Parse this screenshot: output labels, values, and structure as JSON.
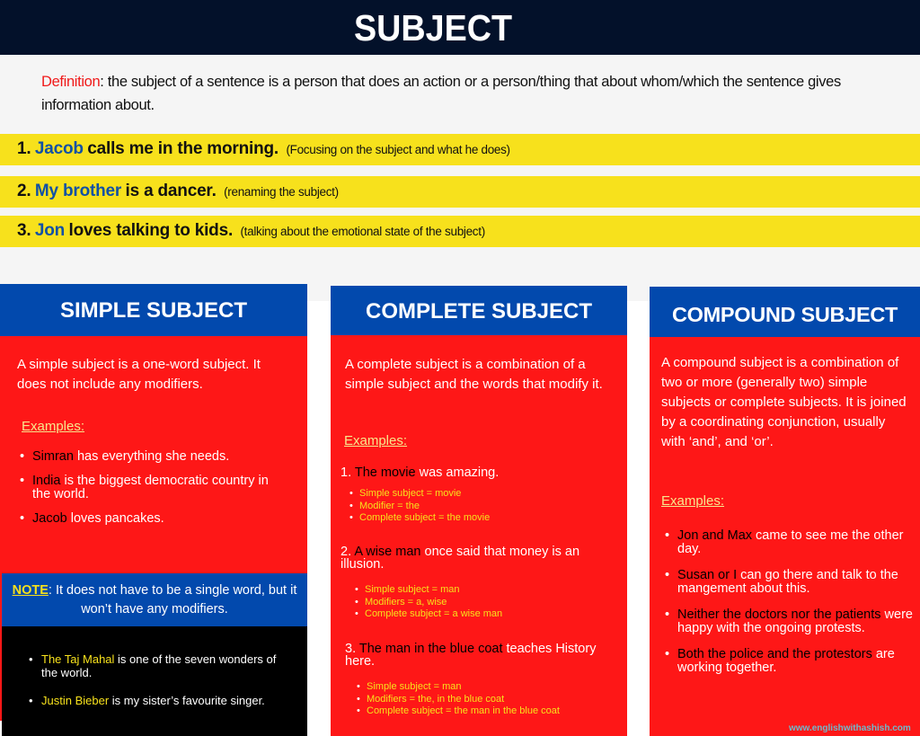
{
  "header": {
    "title": "SUBJECT"
  },
  "definition": {
    "label": "Definition",
    "text": ": the subject of a sentence is a person that does an action or a person/thing that about whom/which the sentence gives information about."
  },
  "examples": [
    {
      "num": "1.",
      "subject": "Jacob",
      "rest": "calls me in the morning.",
      "note": "(Focusing on the subject and what he does)"
    },
    {
      "num": "2.",
      "subject": "My brother",
      "rest": "is a dancer.",
      "note": "(renaming the subject)"
    },
    {
      "num": "3.",
      "subject": "Jon",
      "rest": "loves talking to kids.",
      "note": "(talking about the emotional state of the subject)"
    }
  ],
  "simple": {
    "title": "SIMPLE SUBJECT",
    "description": "A simple subject is a one-word subject. It does not include any modifiers.",
    "examples_label": "Examples:",
    "items": [
      {
        "subject": "Simran",
        "rest": " has everything she needs."
      },
      {
        "subject": "India",
        "rest": " is the biggest democratic country in the world."
      },
      {
        "subject": "Jacob",
        "rest": " loves pancakes."
      }
    ],
    "note_label": "NOTE",
    "note_text": ": It does not have to be a single word, but it won’t have any modifiers.",
    "note_items": [
      {
        "subject": "The Taj Mahal",
        "rest": " is one of the seven wonders of the world."
      },
      {
        "subject": "Justin Bieber",
        "rest": " is my sister’s favourite singer."
      }
    ]
  },
  "complete": {
    "title": "COMPLETE SUBJECT",
    "description": "A complete subject is a combination of a simple subject and the words that modify it.",
    "examples_label": "Examples:",
    "items": [
      {
        "num": "1.",
        "subject": "The movie",
        "rest": " was amazing.",
        "details": [
          "Simple subject = movie",
          "Modifier = the",
          "Complete subject = the movie"
        ]
      },
      {
        "num": "2.",
        "subject": "A wise man",
        "rest": " once said that money is an illusion.",
        "details": [
          "Simple subject = man",
          "Modifiers = a, wise",
          "Complete subject = a wise man"
        ]
      },
      {
        "num": "3.",
        "subject": "The man in the blue coat",
        "rest": " teaches History here.",
        "details": [
          "Simple subject = man",
          "Modifiers = the, in the blue coat",
          "Complete subject = the man in the blue coat"
        ]
      }
    ]
  },
  "compound": {
    "title": "COMPOUND SUBJECT",
    "description": "A compound subject is a combination of two or more (generally two) simple subjects or complete subjects. It is joined by a coordinating conjunction, usually with ‘and’, and ‘or’.",
    "examples_label": "Examples:",
    "items": [
      {
        "subject": "Jon and Max",
        "rest": " came to see me the other day."
      },
      {
        "subject": "Susan or I",
        "rest": " can go there and talk to the mangement about this."
      },
      {
        "subject": "Neither the doctors nor the patients",
        "rest": " were happy with the ongoing protests."
      },
      {
        "subject": "Both the police and the protestors",
        "rest": " are working together."
      }
    ]
  },
  "footer": {
    "watermark": "www.englishwithashish.com"
  },
  "colors": {
    "header_bg": "#03112a",
    "highlight_yellow": "#f7e11c",
    "subject_blue": "#1151a5",
    "card_blue": "#0249ad",
    "card_red": "#fe1717",
    "definition_red": "#f01a1a"
  }
}
